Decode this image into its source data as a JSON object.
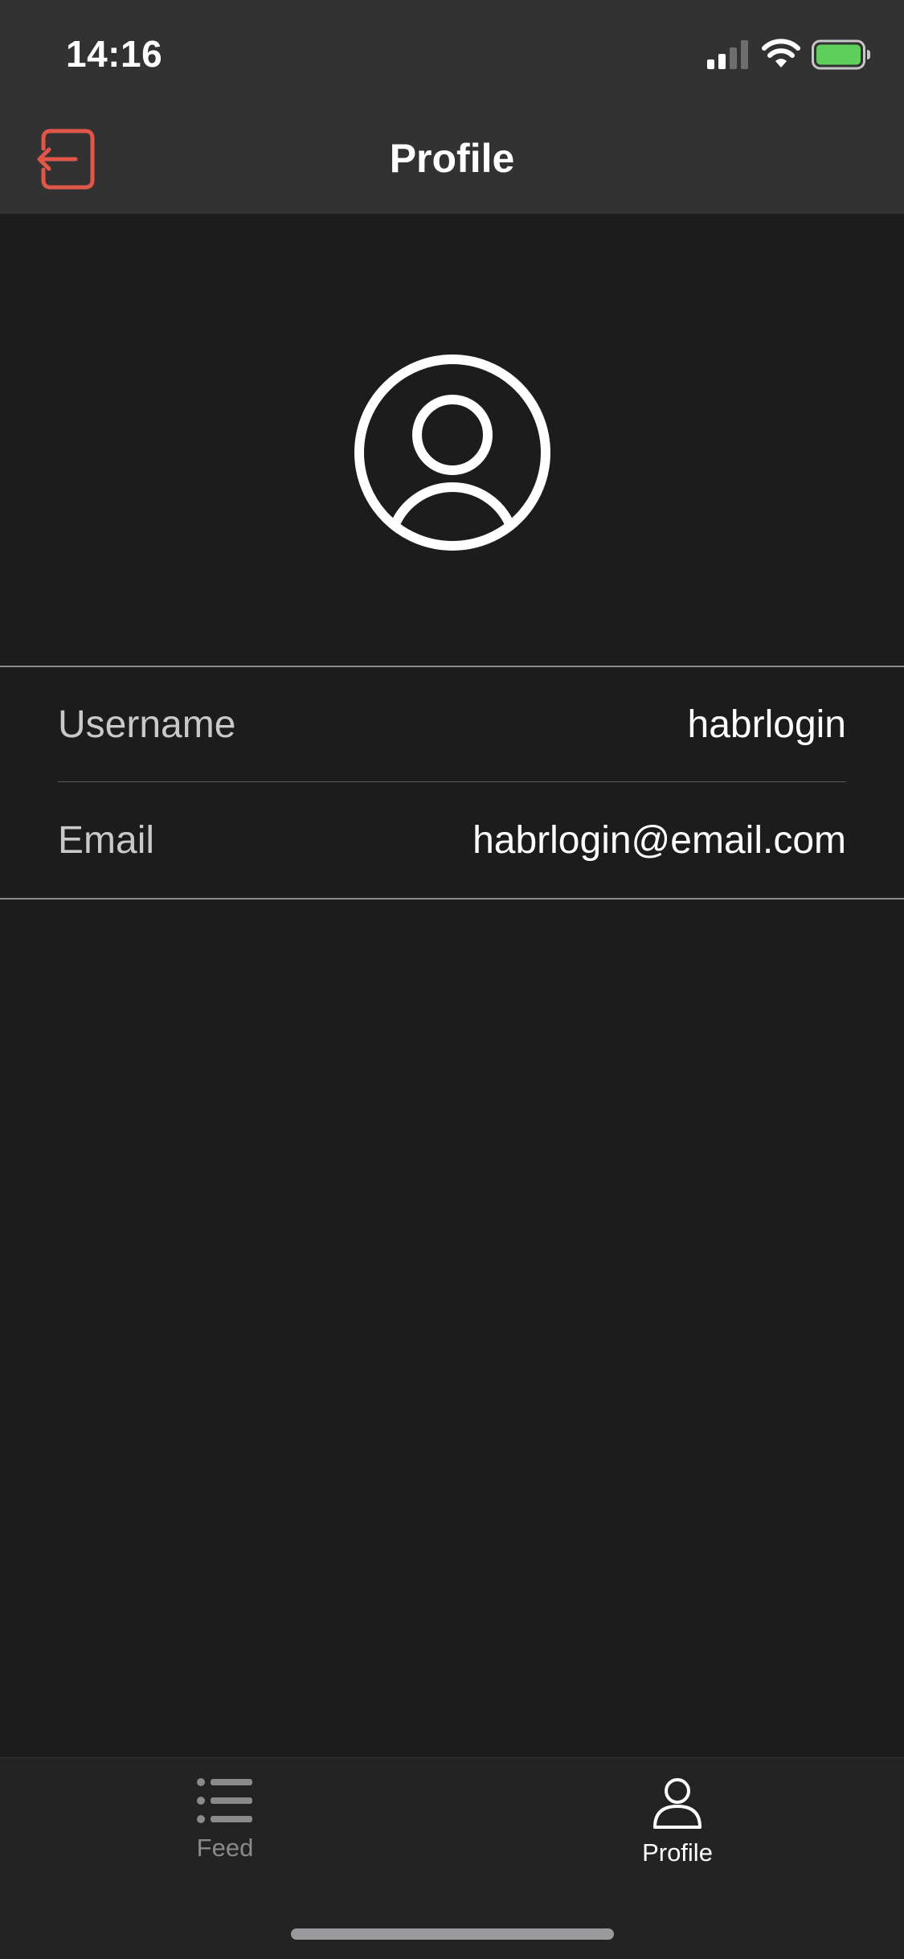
{
  "status_bar": {
    "time": "14:16",
    "icons": [
      "cellular-signal-icon",
      "wifi-icon",
      "battery-icon"
    ],
    "battery_color": "#5fcf5c"
  },
  "nav": {
    "title": "Profile",
    "left_icon": "logout-icon",
    "accent_color": "#e0574a"
  },
  "avatar": {
    "icon": "user-circle-icon"
  },
  "profile": {
    "rows": [
      {
        "label": "Username",
        "value": "habrlogin"
      },
      {
        "label": "Email",
        "value": "habrlogin@email.com"
      }
    ]
  },
  "tabbar": {
    "tabs": [
      {
        "label": "Feed",
        "icon": "list-icon",
        "selected": false
      },
      {
        "label": "Profile",
        "icon": "person-icon",
        "selected": true
      }
    ]
  }
}
